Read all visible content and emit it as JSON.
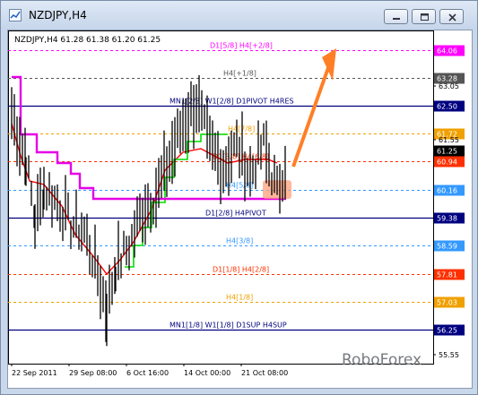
{
  "window": {
    "title": "NZDJPY,H4",
    "buttons": [
      "minimize",
      "restore",
      "close"
    ]
  },
  "chart_info": "NZDJPY,H4  61.28 61.38 61.20 61.25",
  "watermark": "RoboForex",
  "chart_data": {
    "type": "candlestick",
    "symbol": "NZDJPY",
    "timeframe": "H4",
    "ohlc": {
      "open": 61.28,
      "high": 61.38,
      "low": 61.2,
      "close": 61.25
    },
    "current_price": "61.25",
    "y_ticks": [
      "63.05",
      "62.50",
      "61.72",
      "61.55",
      "60.94",
      "60.16",
      "59.38",
      "58.59",
      "57.81",
      "57.03",
      "56.25",
      "55.55"
    ],
    "x_ticks": [
      "22 Sep 2011",
      "29 Sep 08:00",
      "6 Oct 16:00",
      "14 Oct 00:00",
      "21 Oct 08:00"
    ],
    "levels": [
      {
        "price": 64.06,
        "label": "D1[5/8] H4[+2/8]",
        "color": "#ff00ff",
        "tag": "64.06"
      },
      {
        "price": 63.28,
        "label": "H4[+1/8]",
        "color": "#555555",
        "tag": "63.28"
      },
      {
        "price": 62.5,
        "label": "MN1[2/8] W1[2/8] D1PIVOT H4RES",
        "color": "#000080",
        "tag": "62.50"
      },
      {
        "price": 61.72,
        "label": "H4[7/8]",
        "color": "#f0a000",
        "tag": "61.72"
      },
      {
        "price": 60.94,
        "label": "D1[3/8] H4[6/8]",
        "color": "#ff3000",
        "tag": "60.94"
      },
      {
        "price": 60.16,
        "label": "H4[5/8]",
        "color": "#3399ff",
        "tag": "60.16"
      },
      {
        "price": 59.38,
        "label": "D1[2/8] H4PIVOT",
        "color": "#000080",
        "tag": "59.38"
      },
      {
        "price": 58.59,
        "label": "H4[3/8]",
        "color": "#3399ff",
        "tag": "58.59"
      },
      {
        "price": 57.81,
        "label": "D1[1/8] H4[2/8]",
        "color": "#ff3000",
        "tag": "57.81"
      },
      {
        "price": 57.03,
        "label": "H4[1/8]",
        "color": "#f0a000",
        "tag": "57.03"
      },
      {
        "price": 56.25,
        "label": "MN1[1/8] W1[1/8] D1SUP H4SUP",
        "color": "#000080",
        "tag": "56.25"
      }
    ],
    "ylim": [
      55.3,
      64.5
    ]
  }
}
